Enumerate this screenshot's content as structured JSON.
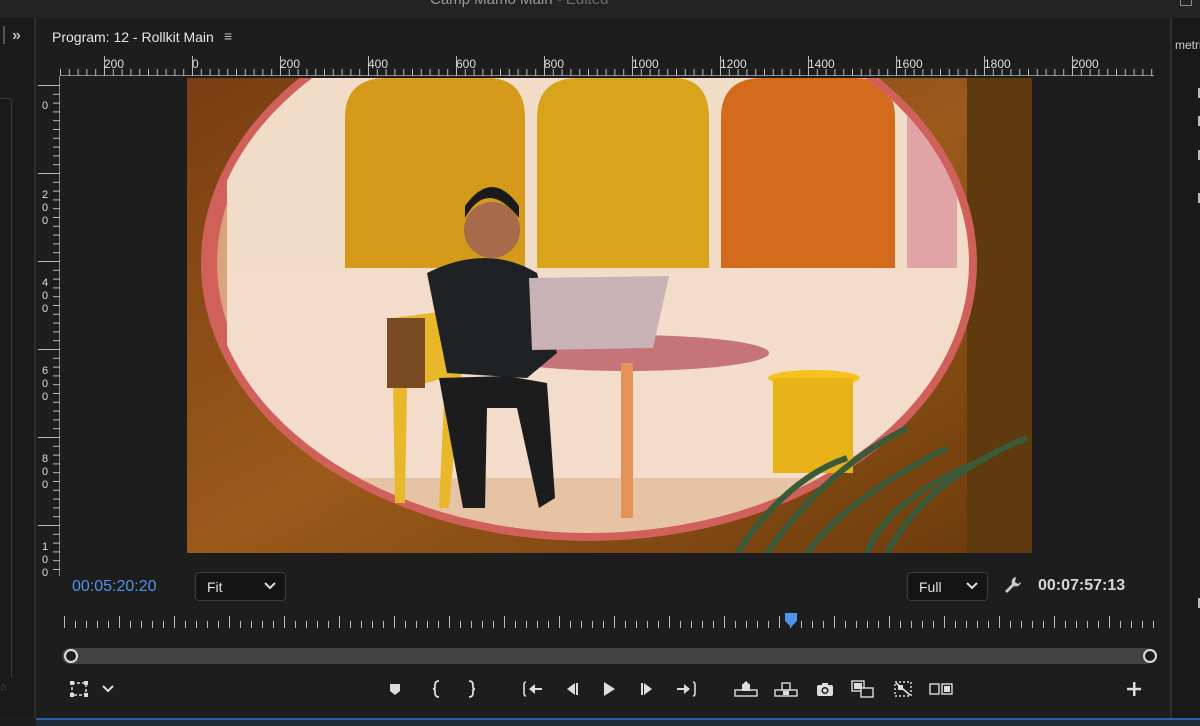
{
  "app": {
    "title": "Camp Mamo Main",
    "suffix": " - Edited"
  },
  "panel": {
    "title": "Program: 12 - Rollkit Main"
  },
  "ruler": {
    "h_labels": [
      "200",
      "0",
      "200",
      "400",
      "600",
      "800",
      "1000",
      "1200",
      "1400",
      "1600",
      "1800",
      "2000"
    ],
    "v_labels": [
      [
        "0"
      ],
      [
        "2",
        "0",
        "0"
      ],
      [
        "4",
        "0",
        "0"
      ],
      [
        "6",
        "0",
        "0"
      ],
      [
        "8",
        "0",
        "0"
      ],
      [
        "1",
        "0",
        "0"
      ]
    ]
  },
  "controls": {
    "timecode_current": "00:05:20:20",
    "zoom": "Fit",
    "resolution": "Full",
    "timecode_duration": "00:07:57:13"
  },
  "playhead": {
    "position_fraction": 0.667
  },
  "right_panel": {
    "label": "metri"
  },
  "colors": {
    "accent": "#4f93ea",
    "panel_bg": "#1d1d1d"
  },
  "icons": [
    "expand-panel-icon",
    "panel-menu-icon",
    "chevron-down-icon",
    "wrench-icon",
    "safe-margins-icon",
    "add-marker-icon",
    "mark-in-icon",
    "mark-out-icon",
    "go-to-in-icon",
    "step-back-icon",
    "play-icon",
    "step-forward-icon",
    "go-to-out-icon",
    "lift-icon",
    "extract-icon",
    "export-frame-icon",
    "insert-icon",
    "comparison-view-icon",
    "toggle-proxies-icon",
    "button-editor-icon"
  ]
}
